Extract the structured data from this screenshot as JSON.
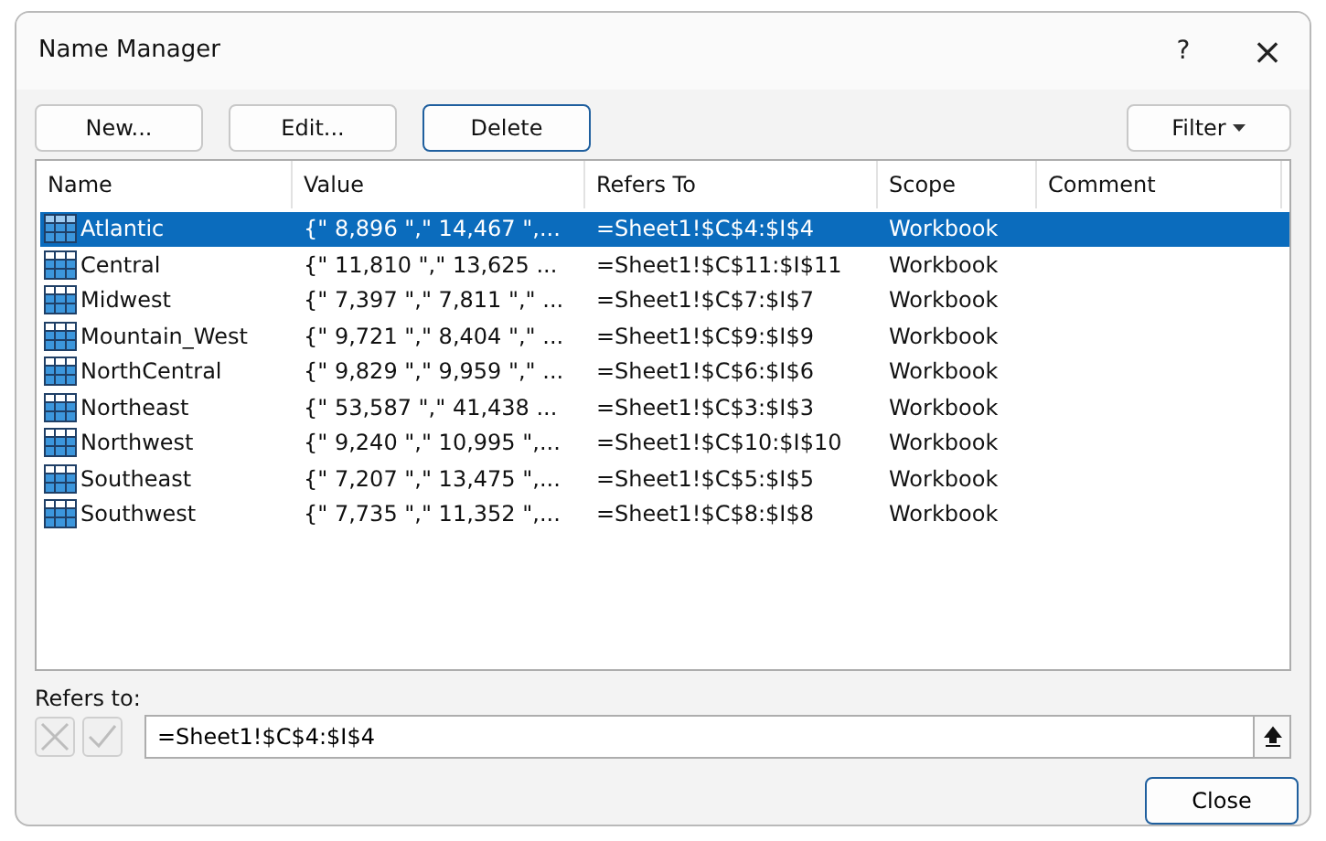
{
  "window": {
    "title": "Name Manager",
    "help": "?",
    "close": "×"
  },
  "toolbar": {
    "buttons": [
      {
        "label": "New...",
        "focused": false
      },
      {
        "label": "Edit...",
        "focused": false
      },
      {
        "label": "Delete",
        "focused": true
      }
    ],
    "filter": "Filter"
  },
  "table": {
    "columns": [
      "Name",
      "Value",
      "Refers To",
      "Scope",
      "Comment"
    ],
    "rows": [
      {
        "name": "Atlantic",
        "value": "{\" 8,896 \",\" 14,467 \",...",
        "refers_to": "=Sheet1!$C$4:$I$4",
        "scope": "Workbook",
        "selected": true
      },
      {
        "name": "Central",
        "value": "{\" 11,810 \",\" 13,625 ...",
        "refers_to": "=Sheet1!$C$11:$I$11",
        "scope": "Workbook",
        "selected": false
      },
      {
        "name": "Midwest",
        "value": "{\" 7,397 \",\" 7,811 \",\" ...",
        "refers_to": "=Sheet1!$C$7:$I$7",
        "scope": "Workbook",
        "selected": false
      },
      {
        "name": "Mountain_West",
        "value": "{\" 9,721 \",\" 8,404 \",\" ...",
        "refers_to": "=Sheet1!$C$9:$I$9",
        "scope": "Workbook",
        "selected": false
      },
      {
        "name": "NorthCentral",
        "value": "{\" 9,829 \",\" 9,959 \",\" ...",
        "refers_to": "=Sheet1!$C$6:$I$6",
        "scope": "Workbook",
        "selected": false
      },
      {
        "name": "Northeast",
        "value": "{\" 53,587 \",\" 41,438 ...",
        "refers_to": "=Sheet1!$C$3:$I$3",
        "scope": "Workbook",
        "selected": false
      },
      {
        "name": "Northwest",
        "value": "{\" 9,240 \",\" 10,995 \",...",
        "refers_to": "=Sheet1!$C$10:$I$10",
        "scope": "Workbook",
        "selected": false
      },
      {
        "name": "Southeast",
        "value": "{\" 7,207 \",\" 13,475 \",...",
        "refers_to": "=Sheet1!$C$5:$I$5",
        "scope": "Workbook",
        "selected": false
      },
      {
        "name": "Southwest",
        "value": "{\" 7,735 \",\" 11,352 \",...",
        "refers_to": "=Sheet1!$C$8:$I$8",
        "scope": "Workbook",
        "selected": false
      }
    ]
  },
  "refers_to": {
    "label": "Refers to:",
    "value": "=Sheet1!$C$4:$I$4",
    "cancel_disabled": true,
    "confirm_disabled": true
  },
  "footer": {
    "close": "Close"
  }
}
